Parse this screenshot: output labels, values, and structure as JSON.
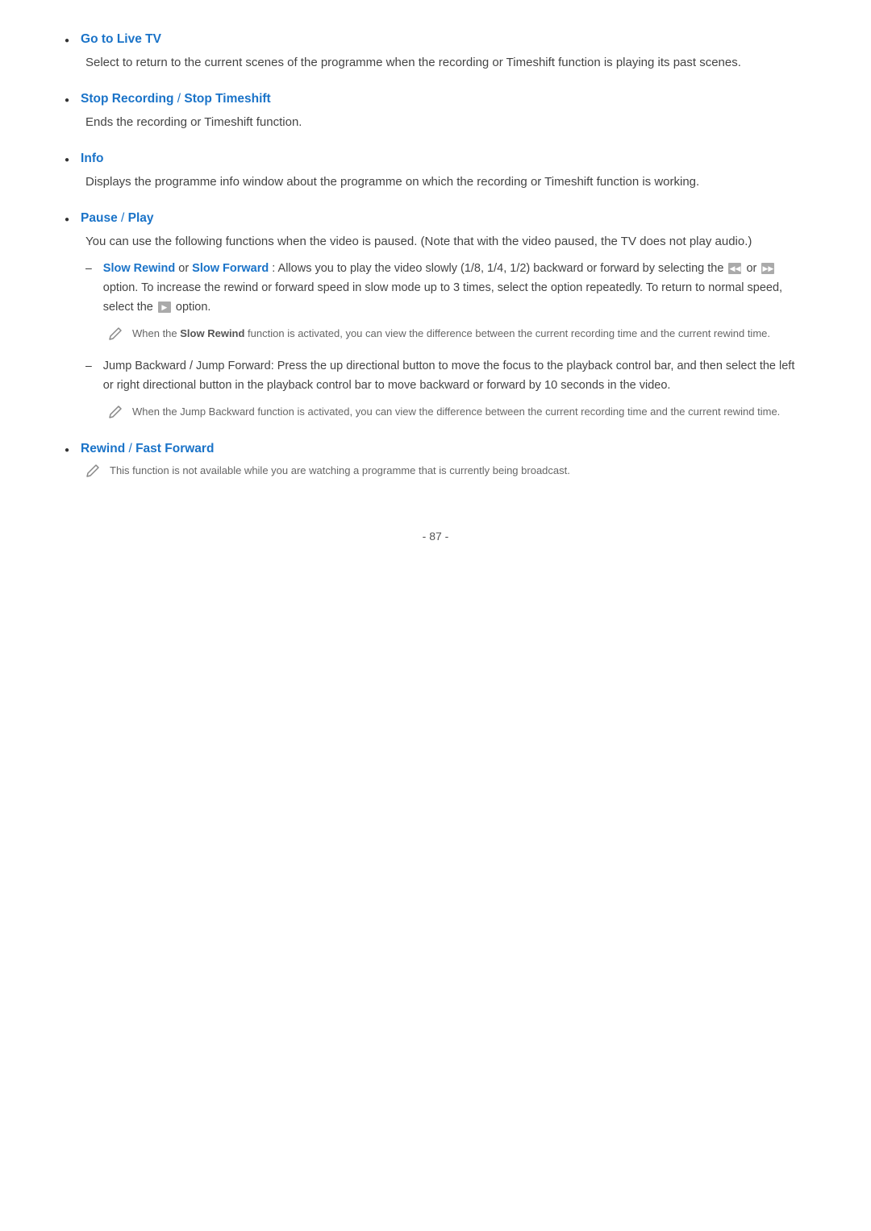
{
  "page": {
    "footer": "- 87 -"
  },
  "items": [
    {
      "id": "go-to-live-tv",
      "title": "Go to Live TV",
      "title_color": "#1a73c8",
      "separator": null,
      "body": "Select to return to the current scenes of the programme when the recording or Timeshift function is playing its past scenes."
    },
    {
      "id": "stop-recording",
      "title": "Stop Recording",
      "separator": " / ",
      "title2": "Stop Timeshift",
      "body": "Ends the recording or Timeshift function."
    },
    {
      "id": "info",
      "title": "Info",
      "separator": null,
      "body": "Displays the programme info window about the programme on which the recording or Timeshift function is working."
    },
    {
      "id": "pause-play",
      "title": "Pause",
      "separator": " / ",
      "title2": "Play",
      "body": "You can use the following functions when the video is paused. (Note that with the video paused, the TV does not play audio.)",
      "sub_items": [
        {
          "id": "slow-rewind-forward",
          "dash": "–",
          "title1": "Slow Rewind",
          "sep": " or ",
          "title2": "Slow Forward",
          "rest_before": ": Allows you to play the video slowly (1/8, 1/4, 1/2) backward or forward by selecting the ",
          "icon1": "◀◀",
          "mid": " or ",
          "icon2": "▶▶",
          "rest_after": " option. To increase the rewind or forward speed in slow mode up to 3 times, select the option repeatedly. To return to normal speed, select the ",
          "icon3": "▶",
          "end": " option.",
          "note": {
            "text_before": "When the ",
            "bold": "Slow Rewind",
            "text_after": " function is activated, you can view the difference between the current recording time and the current rewind time."
          }
        },
        {
          "id": "jump-backward-forward",
          "dash": "–",
          "plain_text": "Jump Backward / Jump Forward: Press the up directional button to move the focus to the playback control bar, and then select the left or right directional button in the playback control bar to move backward or forward by 10 seconds in the video.",
          "note": {
            "text_before": "When the Jump Backward function is activated, you can view the difference between the current recording time and the current rewind time.",
            "bold": null
          }
        }
      ]
    },
    {
      "id": "rewind-fast-forward",
      "title": "Rewind",
      "separator": " / ",
      "title2": "Fast Forward",
      "body": null,
      "note": {
        "text": "This function is not available while you are watching a programme that is currently being broadcast.",
        "bold": null
      }
    }
  ]
}
